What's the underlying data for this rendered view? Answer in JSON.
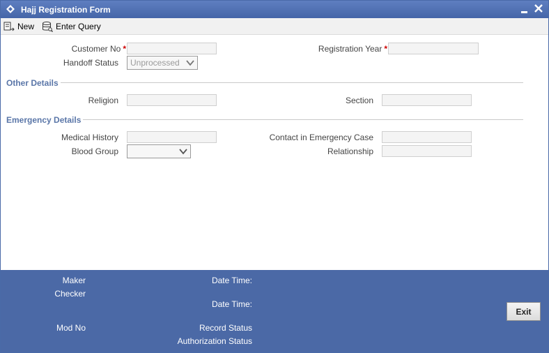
{
  "window": {
    "title": "Hajj Registration Form"
  },
  "toolbar": {
    "new_label": "New",
    "enter_query_label": "Enter Query"
  },
  "form": {
    "customer_no_label": "Customer No",
    "customer_no_value": "",
    "registration_year_label": "Registration Year",
    "registration_year_value": "",
    "required_marker": "*",
    "handoff_status_label": "Handoff Status",
    "handoff_status_value": "Unprocessed"
  },
  "other_details": {
    "title": "Other Details",
    "religion_label": "Religion",
    "religion_value": "",
    "section_label": "Section",
    "section_value": ""
  },
  "emergency_details": {
    "title": "Emergency Details",
    "medical_history_label": "Medical History",
    "medical_history_value": "",
    "contact_label": "Contact in Emergency Case",
    "contact_value": "",
    "blood_group_label": "Blood Group",
    "blood_group_value": "",
    "relationship_label": "Relationship",
    "relationship_value": ""
  },
  "footer": {
    "maker_label": "Maker",
    "date_time_label_1": "Date Time:",
    "checker_label": "Checker",
    "date_time_label_2": "Date Time:",
    "mod_no_label": "Mod No",
    "record_status_label": "Record Status",
    "authorization_status_label": "Authorization Status",
    "exit_label": "Exit"
  },
  "icons": {
    "logo": "diamond-logo-icon",
    "minimize": "minimize-icon",
    "close": "close-icon",
    "new": "new-document-icon",
    "enter_query": "database-query-icon",
    "dropdown": "chevron-down-icon"
  },
  "colors": {
    "titlebar": "#4a6aa8",
    "footer": "#4b69a6",
    "section_title": "#5a76a8",
    "required": "#cc0000"
  }
}
